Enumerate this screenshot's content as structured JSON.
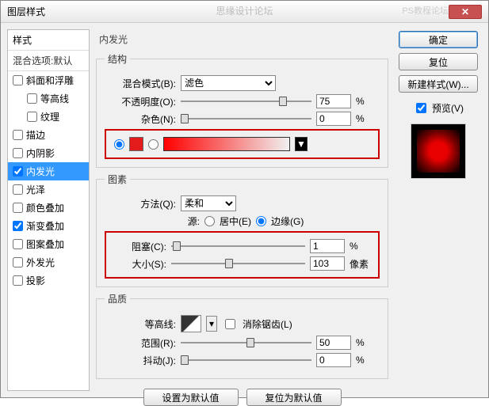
{
  "title": "图层样式",
  "watermark_center": "思缘设计论坛",
  "watermark_right": "PS教程论坛",
  "left": {
    "head": "样式",
    "sub": "混合选项:默认",
    "items": [
      {
        "label": "斜面和浮雕",
        "checked": false,
        "indent": false
      },
      {
        "label": "等高线",
        "checked": false,
        "indent": true
      },
      {
        "label": "纹理",
        "checked": false,
        "indent": true
      },
      {
        "label": "描边",
        "checked": false,
        "indent": false
      },
      {
        "label": "内阴影",
        "checked": false,
        "indent": false
      },
      {
        "label": "内发光",
        "checked": true,
        "indent": false,
        "selected": true
      },
      {
        "label": "光泽",
        "checked": false,
        "indent": false
      },
      {
        "label": "颜色叠加",
        "checked": false,
        "indent": false
      },
      {
        "label": "渐变叠加",
        "checked": true,
        "indent": false
      },
      {
        "label": "图案叠加",
        "checked": false,
        "indent": false
      },
      {
        "label": "外发光",
        "checked": false,
        "indent": false
      },
      {
        "label": "投影",
        "checked": false,
        "indent": false
      }
    ]
  },
  "center": {
    "header": "内发光",
    "structure": {
      "legend": "结构",
      "blend_label": "混合模式(B):",
      "blend_value": "滤色",
      "opacity_label": "不透明度(O):",
      "opacity_value": "75",
      "opacity_unit": "%",
      "noise_label": "杂色(N):",
      "noise_value": "0",
      "noise_unit": "%",
      "color_radio_solid": true,
      "color_radio_gradient": false,
      "solid_color": "#ff0000"
    },
    "elements": {
      "legend": "图素",
      "technique_label": "方法(Q):",
      "technique_value": "柔和",
      "source_label": "源:",
      "source_center": "居中(E)",
      "source_edge": "边缘(G)",
      "source_selected": "edge",
      "choke_label": "阻塞(C):",
      "choke_value": "1",
      "choke_unit": "%",
      "size_label": "大小(S):",
      "size_value": "103",
      "size_unit": "像素"
    },
    "quality": {
      "legend": "品质",
      "contour_label": "等高线:",
      "antialias": "消除锯齿(L)",
      "range_label": "范围(R):",
      "range_value": "50",
      "range_unit": "%",
      "jitter_label": "抖动(J):",
      "jitter_value": "0",
      "jitter_unit": "%"
    },
    "defaults": {
      "set": "设置为默认值",
      "reset": "复位为默认值"
    }
  },
  "right": {
    "ok": "确定",
    "cancel": "复位",
    "new_style": "新建样式(W)...",
    "preview": "预览(V)"
  }
}
